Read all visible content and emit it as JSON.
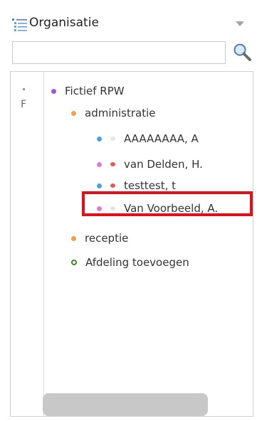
{
  "header": {
    "title": "Organisatie",
    "icon": "org-list-icon"
  },
  "search": {
    "value": "",
    "placeholder": ""
  },
  "gutter": {
    "letter": "F"
  },
  "tree": {
    "root": {
      "label": "Fictief RPW",
      "color": "#9b59d6"
    },
    "departments": [
      {
        "label": "administratie",
        "color": "#f0a050",
        "members": [
          {
            "label": "AAAAAAAA, A",
            "role_color": "#4aa3df",
            "status_color": "#e4e4e4"
          },
          {
            "label": "van Delden, H.",
            "role_color": "#e07ad8",
            "status_color": "#e05a50"
          },
          {
            "label": "testtest, t",
            "role_color": "#4aa3df",
            "status_color": "#e05a50"
          },
          {
            "label": "Van Voorbeeld, A.",
            "role_color": "#e07ad8",
            "status_color": "#e4e4e4"
          }
        ]
      },
      {
        "label": "receptie",
        "color": "#f0a050",
        "members": []
      }
    ],
    "add_department": {
      "label": "Afdeling toevoegen",
      "color": "#3a8a2e"
    }
  },
  "highlight_color": "#e0101a"
}
